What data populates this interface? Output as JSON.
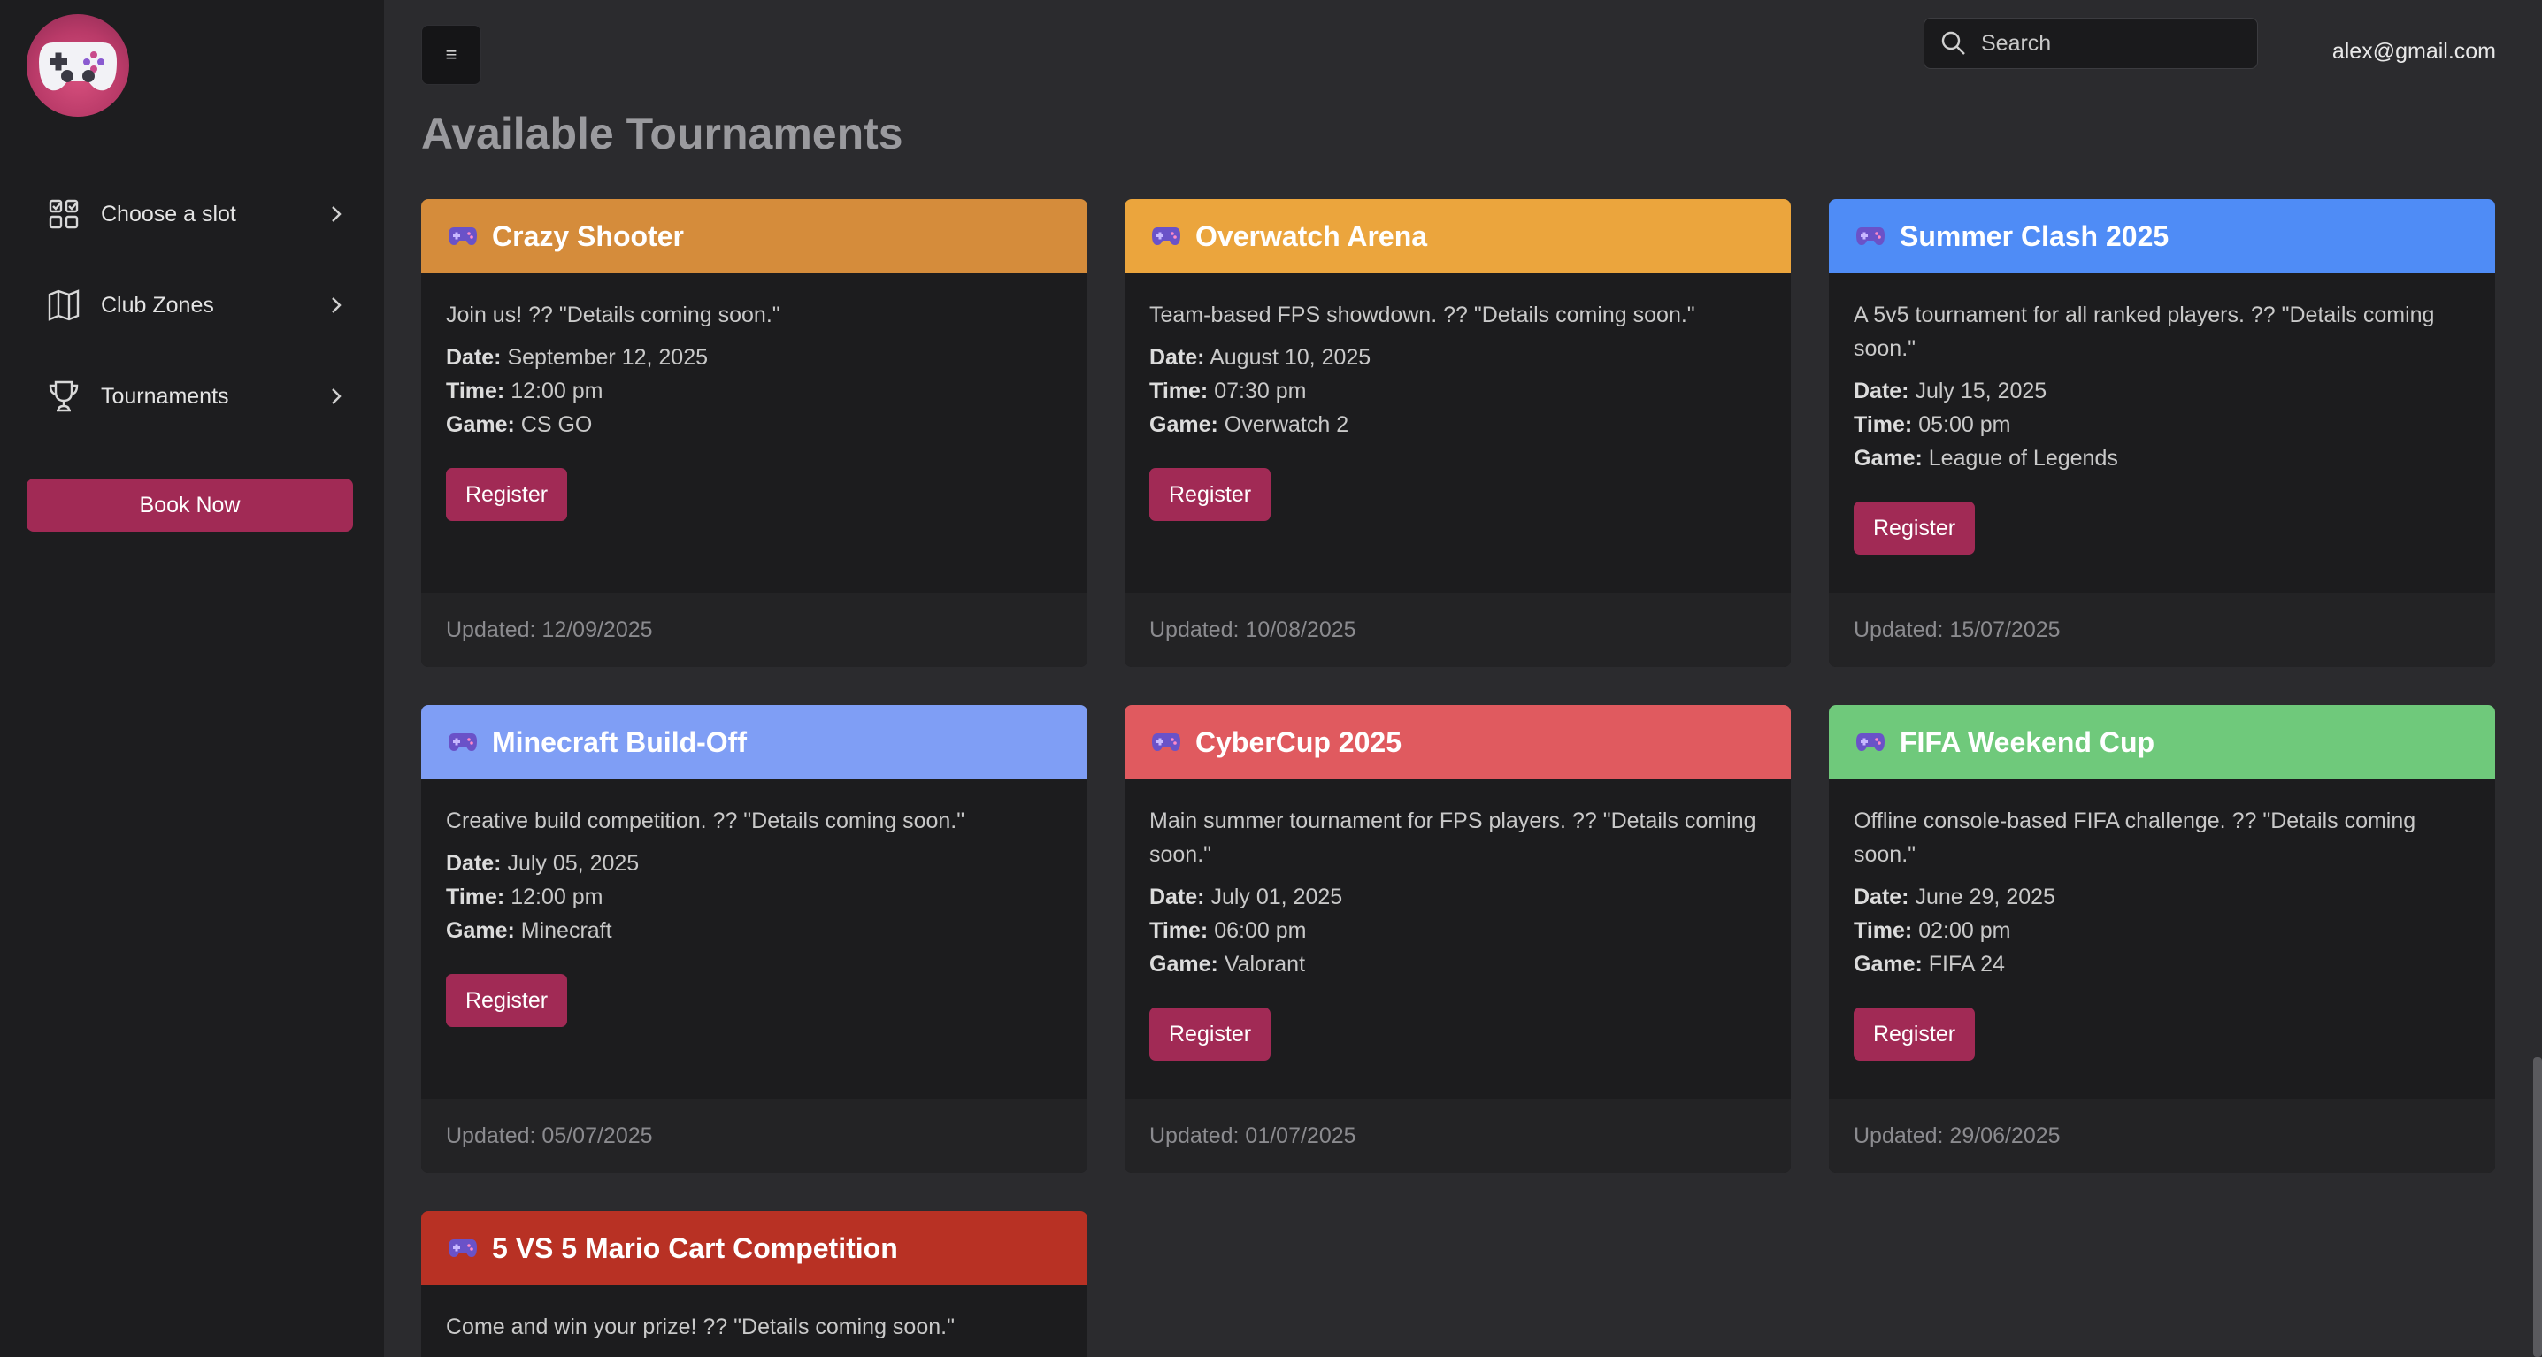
{
  "sidebar": {
    "items": [
      {
        "label": "Choose a slot",
        "icon": "grid-check-icon"
      },
      {
        "label": "Club Zones",
        "icon": "map-icon"
      },
      {
        "label": "Tournaments",
        "icon": "trophy-icon"
      }
    ],
    "book_label": "Book Now"
  },
  "header": {
    "menu_glyph": "≡",
    "search_placeholder": "Search",
    "user_email": "alex@gmail.com"
  },
  "page": {
    "title": "Available Tournaments"
  },
  "labels": {
    "date": "Date:",
    "time": "Time:",
    "game": "Game:",
    "register": "Register"
  },
  "colors": {
    "accent": "#a12a55",
    "card_orange": "#d58c3b",
    "card_amber": "#eba53d",
    "card_blue": "#4f8cf6",
    "card_periwinkle": "#7f9ef5",
    "card_red": "#e05a5f",
    "card_green": "#6fc97b",
    "card_crimson": "#b83124"
  },
  "tournaments": [
    {
      "title": "Crazy Shooter",
      "description": "Join us! ?? \"Details coming soon.\"",
      "date": "September 12, 2025",
      "time": "12:00 pm",
      "game": "CS GO",
      "updated": "Updated: 12/09/2025"
    },
    {
      "title": "Overwatch Arena",
      "description": "Team-based FPS showdown. ?? \"Details coming soon.\"",
      "date": "August 10, 2025",
      "time": "07:30 pm",
      "game": "Overwatch 2",
      "updated": "Updated: 10/08/2025"
    },
    {
      "title": "Summer Clash 2025",
      "description": "A 5v5 tournament for all ranked players. ?? \"Details coming soon.\"",
      "date": "July 15, 2025",
      "time": "05:00 pm",
      "game": "League of Legends",
      "updated": "Updated: 15/07/2025"
    },
    {
      "title": "Minecraft Build-Off",
      "description": "Creative build competition. ?? \"Details coming soon.\"",
      "date": "July 05, 2025",
      "time": "12:00 pm",
      "game": "Minecraft",
      "updated": "Updated: 05/07/2025"
    },
    {
      "title": "CyberCup 2025",
      "description": "Main summer tournament for FPS players. ?? \"Details coming soon.\"",
      "date": "July 01, 2025",
      "time": "06:00 pm",
      "game": "Valorant",
      "updated": "Updated: 01/07/2025"
    },
    {
      "title": "FIFA Weekend Cup",
      "description": "Offline console-based FIFA challenge. ?? \"Details coming soon.\"",
      "date": "June 29, 2025",
      "time": "02:00 pm",
      "game": "FIFA 24",
      "updated": "Updated: 29/06/2025"
    },
    {
      "title": "5 VS 5 Mario Cart Competition",
      "description": "Come and win your prize! ?? \"Details coming soon.\""
    }
  ]
}
